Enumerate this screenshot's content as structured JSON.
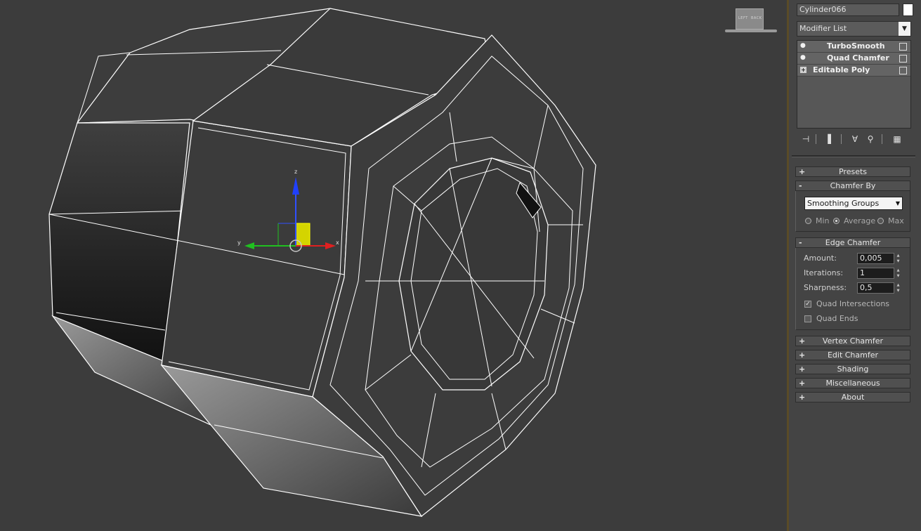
{
  "viewport": {
    "viewcube_left": "LEFT",
    "viewcube_back": "BACK",
    "gizmo_axes": {
      "x": "x",
      "y": "y",
      "z": "z"
    }
  },
  "command_panel": {
    "object_name": "Cylinder066",
    "object_color": "#ffffff",
    "modifier_list_label": "Modifier List",
    "stack": [
      {
        "label": "TurboSmooth",
        "icon": "lightbulb-icon"
      },
      {
        "label": "Quad Chamfer",
        "icon": "lightbulb-icon"
      },
      {
        "label": "Editable Poly",
        "icon": "expand-icon"
      }
    ],
    "stack_tools": [
      "pin-stack-icon",
      "show-end-result-icon",
      "make-unique-icon",
      "remove-modifier-icon",
      "configure-sets-icon"
    ]
  },
  "rollouts": {
    "presets": {
      "sign": "+",
      "label": "Presets"
    },
    "chamfer_by": {
      "sign": "-",
      "label": "Chamfer By",
      "dropdown_value": "Smoothing Groups",
      "radios": [
        {
          "label": "Min",
          "selected": false
        },
        {
          "label": "Average",
          "selected": true
        },
        {
          "label": "Max",
          "selected": false
        }
      ]
    },
    "edge_chamfer": {
      "sign": "-",
      "label": "Edge Chamfer",
      "amount_label": "Amount:",
      "amount_value": "0,005",
      "iterations_label": "Iterations:",
      "iterations_value": "1",
      "sharpness_label": "Sharpness:",
      "sharpness_value": "0,5",
      "quad_intersections_label": "Quad Intersections",
      "quad_intersections_checked": true,
      "quad_ends_label": "Quad Ends",
      "quad_ends_checked": false
    },
    "vertex_chamfer": {
      "sign": "+",
      "label": "Vertex Chamfer"
    },
    "edit_chamfer": {
      "sign": "+",
      "label": "Edit Chamfer"
    },
    "shading": {
      "sign": "+",
      "label": "Shading"
    },
    "miscellaneous": {
      "sign": "+",
      "label": "Miscellaneous"
    },
    "about": {
      "sign": "+",
      "label": "About"
    }
  }
}
